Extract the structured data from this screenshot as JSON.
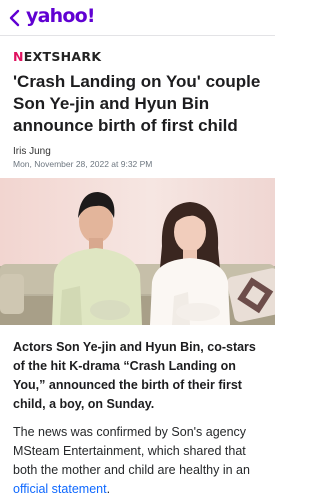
{
  "header": {
    "logo_text": "yahoo!",
    "back_icon": "chevron-left-icon",
    "brand_color": "#6001d2"
  },
  "article": {
    "source_mark": "N",
    "source_rest": "EXTSHARK",
    "headline": "'Crash Landing on You' couple Son Ye-jin and Hyun Bin announce birth of first child",
    "author": "Iris Jung",
    "timestamp": "Mon, November 28, 2022 at 9:32 PM",
    "lede": "Actors Son Ye-jin and Hyun Bin, co-stars of the hit K-drama “Crash Landing on You,” announced the birth of their first child, a boy, on Sunday.",
    "body_text": "The news was confirmed by Son's agency MSteam Entertainment, which shared that both the mother and child are healthy in an ",
    "body_link": "official statement",
    "body_tail": ".",
    "link_color": "#0f69ff"
  }
}
